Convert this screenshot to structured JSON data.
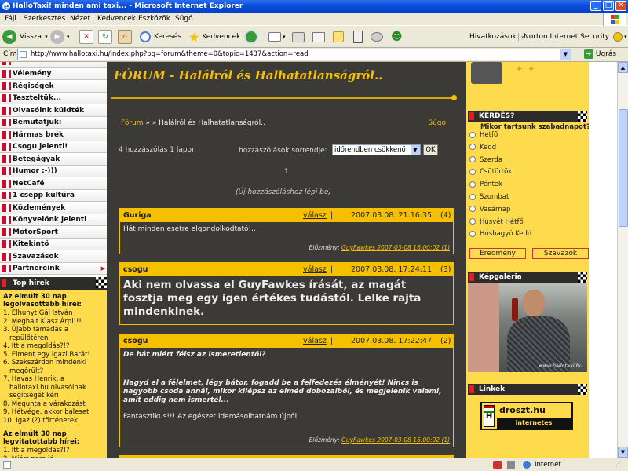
{
  "window": {
    "title": "HallóTaxi! minden ami taxi... - Microsoft Internet Explorer"
  },
  "menu": [
    "Fájl",
    "Szerkesztés",
    "Nézet",
    "Kedvencek",
    "Eszközök",
    "Súgó"
  ],
  "toolbar": {
    "back": "Vissza",
    "search": "Keresés",
    "favorites": "Kedvencek",
    "links": "Hivatkozások",
    "norton": "Norton Internet Security"
  },
  "address": {
    "label": "Cím",
    "url": "http://www.hallotaxi.hu/index.php?pg=forum&theme=0&topic=1437&action=read",
    "go": "Ugrás"
  },
  "nav": {
    "items": [
      "Vélemény",
      "Régiségek",
      "Teszteltük...",
      "Olvasóink küldték",
      "Bemutatjuk:",
      "Hármas brék",
      "Csogu jelenti!",
      "Betegágyak",
      "Humor :-)))",
      "NetCafé",
      "1 csepp kultúra",
      "Közlemények",
      "Könyvelőnk jelenti",
      "MotorSport",
      "Kitekintő",
      "Szavazások",
      "Partnereink"
    ]
  },
  "top_news": {
    "heading": "Top hírek",
    "read_title": "Az elmúlt 30 nap legolvasottabb hírei:",
    "read_items": [
      "1. Elhunyt Gál István",
      "2. Meghalt Klasz Árpi!!!",
      "3. Újabb támadás a repülőtéren",
      "4. Itt a megoldás?!?",
      "5. Elment egy igazi Barát!",
      "6. Szekszárdon mindenki megőrült?",
      "7. Havas Henrik, a hallotaxi.hu olvasóinak segítségét kéri",
      "8. Megunta a várakozást",
      "9. Hétvége, akkor baleset",
      "10. Igaz (?) történetek"
    ],
    "commented_title": "Az elmúlt 30 nap legvitatottabb hírei:",
    "commented_items": [
      "1. Itt a megoldás?!?",
      "2. Miért nem jó,"
    ]
  },
  "forum": {
    "title": "FÓRUM - Halálról és Halhatatlanságról..",
    "crumb_link": "Fórum",
    "crumb_rest": " » » Halálról és Halhatatlanságról..",
    "help": "Súgó",
    "post_count": "4 hozzászólás 1 lapon",
    "sort_label": "hozzászólások sorrendje:",
    "sort_value": "időrendben csökkenő",
    "ok": "OK",
    "page": "1",
    "new_post": "(Új hozzászóláshoz lépj be)",
    "reply": "válasz",
    "sep": "|",
    "prev_label": "Előzmény:",
    "posts": [
      {
        "author": "Guriga",
        "date": "2007.03.08. 21:16:35",
        "num": "(4)",
        "text": "Hát minden esetre elgondolkodtató!..",
        "prev": "GuyFawkes 2007-03-08 16:00:02 (1)"
      },
      {
        "author": "csogu",
        "date": "2007.03.08. 17:24:11",
        "num": "(3)",
        "text": "Aki nem olvassa el GuyFawkes írását, az magát fosztja meg egy igen értékes tudástól. Lelke rajta mindenkinek."
      },
      {
        "author": "csogu",
        "date": "2007.03.08. 17:22:47",
        "num": "(2)",
        "q1": "De hát miért félsz az ismeretlentől?",
        "q2": "Hagyd el a félelmet, légy bátor, fogadd be a felfedezés élményét! Nincs is nagyobb csoda annál, mikor kilépsz az elméd dobozaiból, és megjelenik valami, amit eddig nem ismertél...",
        "text": "Fantasztikus!!! Az egészet idemásolhatnám újból.",
        "prev": "GuyFawkes 2007-03-08 16:00:02 (1)"
      }
    ]
  },
  "poll": {
    "heading": "KÉRDÉS?",
    "question": "Mikor tartsunk szabadnapot?",
    "options": [
      "Hétfő",
      "Kedd",
      "Szerda",
      "Csütörtök",
      "Péntek",
      "Szombat",
      "Vasárnap",
      "Húsvét Hétfő",
      "Húshagyó Kedd"
    ],
    "results": "Eredmény",
    "vote": "Szavazok"
  },
  "gallery": {
    "heading": "Képgaléria",
    "watermark": "www.hallotaxi.hu"
  },
  "links": {
    "heading": "Linkek",
    "droszt_title": "droszt.hu",
    "droszt_sub": "internetes taxiállomás"
  },
  "status": {
    "zone": "Internet"
  },
  "colors": {
    "accent": "#f4c000",
    "page_bg": "#3c3a37",
    "panel": "#fedb4c"
  }
}
